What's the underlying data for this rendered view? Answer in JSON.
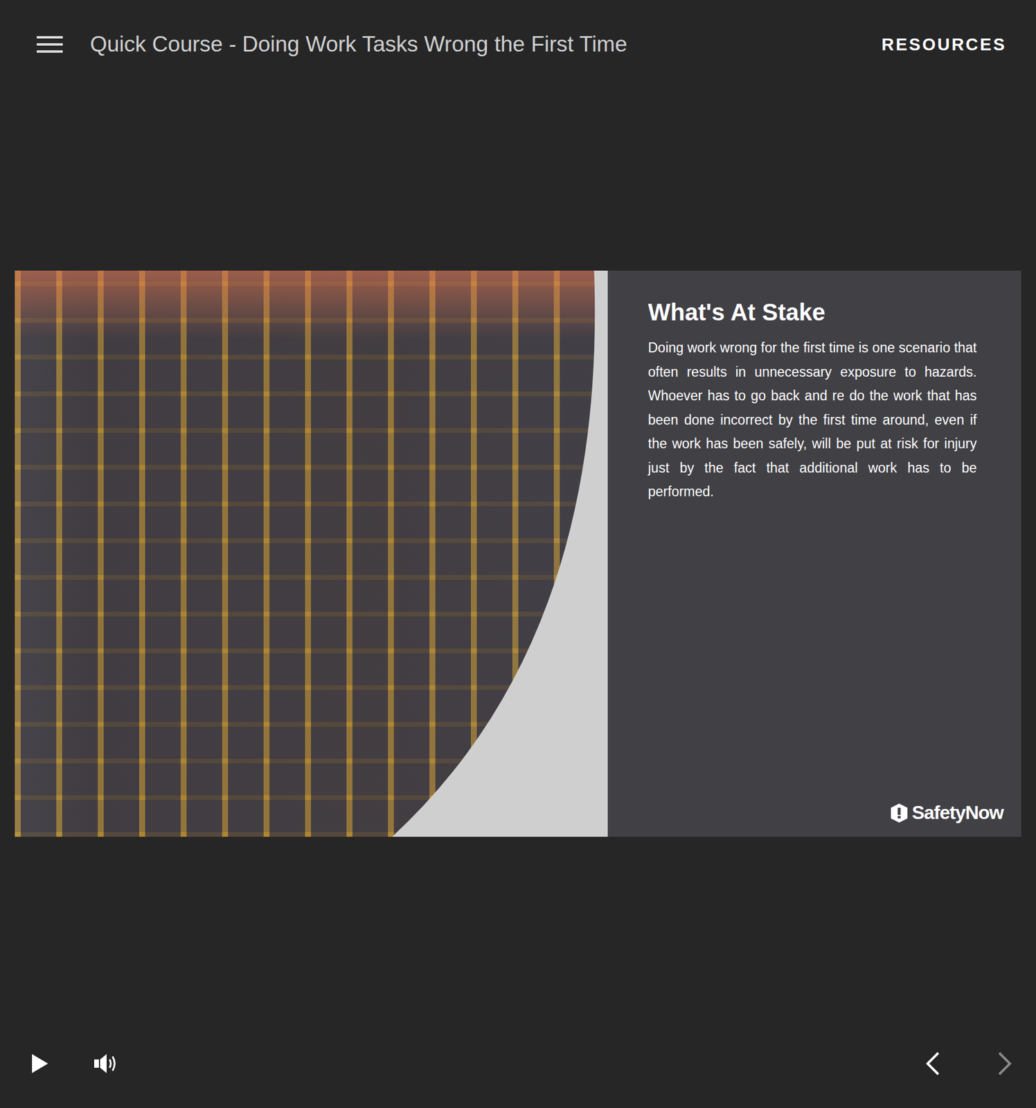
{
  "header": {
    "title": "Quick Course - Doing Work Tasks Wrong the First Time",
    "resources": "RESOURCES"
  },
  "slide": {
    "heading": "What's At Stake",
    "body": "Doing work wrong for the first time is one scenario that often results in unnecessary exposure to hazards. Whoever has to go back and re do the work that has been done incorrect by the first time around, even if the work has been safely, will be put at risk for injury just by the fact that additional work has to be performed.",
    "logo": "SafetyNow"
  },
  "controls": {
    "prev": {
      "disabled": false
    },
    "next": {
      "disabled": true
    }
  }
}
